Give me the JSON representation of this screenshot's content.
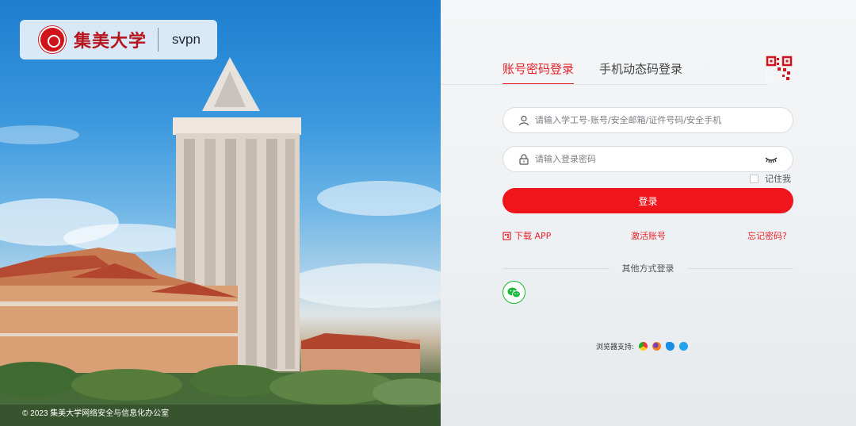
{
  "brand": {
    "university_name": "集美大学",
    "product": "svpn",
    "copyright": "© 2023 集美大学网络安全与信息化办公室"
  },
  "login": {
    "tabs": [
      {
        "label": "账号密码登录",
        "active": true
      },
      {
        "label": "手机动态码登录",
        "active": false
      }
    ],
    "username_placeholder": "请输入学工号-账号/安全邮箱/证件号码/安全手机",
    "password_placeholder": "请输入登录密码",
    "remember_label": "记住我",
    "submit_label": "登录",
    "download_app_label": "下载 APP",
    "activate_account_label": "激活账号",
    "forgot_password_label": "忘记密码?",
    "other_methods_label": "其他方式登录",
    "browser_support_label": "浏览器支持:"
  },
  "icons": {
    "qr_toggle": "qr-code-icon",
    "user": "user-icon",
    "lock": "lock-icon",
    "eye": "eye-closed-icon",
    "app": "download-app-icon",
    "wechat": "wechat-icon",
    "browsers": [
      "chrome-icon",
      "firefox-icon",
      "ie-icon",
      "qq-browser-icon"
    ]
  },
  "colors": {
    "accent": "#e8222b",
    "button": "#f0141c",
    "wechat": "#16b93a",
    "brand": "#b8141e"
  }
}
